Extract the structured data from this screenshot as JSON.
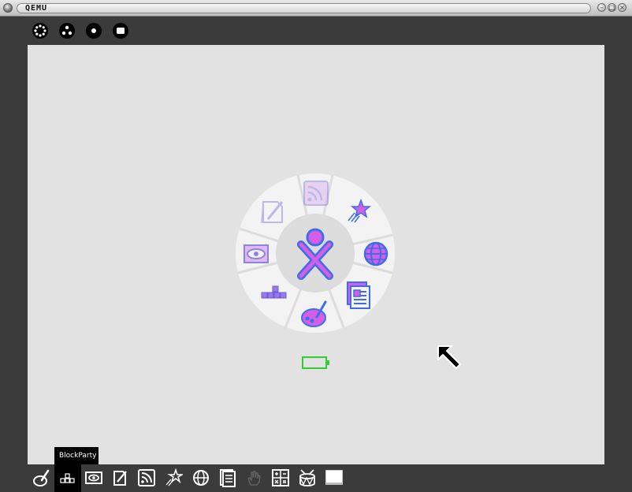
{
  "window": {
    "title": "QEMU"
  },
  "tooltip": {
    "text": "BlockParty"
  },
  "colors": {
    "fill": "#d35fe8",
    "stroke": "#3e6de5",
    "battery": "#33cc33",
    "screen": "#e2e2e2"
  },
  "frame_devices": [
    "neighborhood-icon",
    "group-icon",
    "home-icon",
    "activity-icon"
  ],
  "ring_activities": [
    "news-reader-icon",
    "star-chat-icon",
    "browse-icon",
    "write-document-icon",
    "paint-icon",
    "blockparty-icon",
    "viewer-icon",
    "journal-icon"
  ],
  "activity_bar": [
    "paint-icon",
    "blockparty-icon",
    "viewer-icon",
    "write-icon",
    "news-reader-icon",
    "star-icon",
    "browse-icon",
    "document-icon",
    "hand-icon",
    "calculate-icon",
    "drum-icon",
    "terminal-icon"
  ]
}
